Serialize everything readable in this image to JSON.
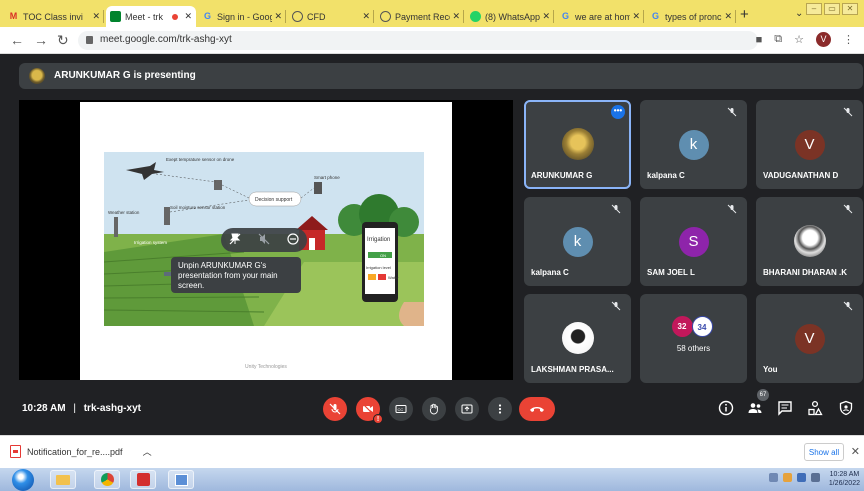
{
  "browser": {
    "tabs": [
      {
        "label": "TOC Class invi",
        "icon": "gmail-icon",
        "active": false
      },
      {
        "label": "Meet - trk",
        "icon": "meet-icon",
        "active": true
      },
      {
        "label": "Sign in - Goog",
        "icon": "google-icon",
        "active": false
      },
      {
        "label": "CFD",
        "icon": "globe-icon",
        "active": false
      },
      {
        "label": "Payment Rece",
        "icon": "globe-icon",
        "active": false
      },
      {
        "label": "(8) WhatsApp",
        "icon": "whatsapp-icon",
        "active": false
      },
      {
        "label": "we are at hom",
        "icon": "google-icon",
        "active": false
      },
      {
        "label": "types of pronc",
        "icon": "google-icon",
        "active": false
      }
    ],
    "url": "meet.google.com/trk-ashg-xyt",
    "profile_initial": "V"
  },
  "meeting": {
    "presenting_text": "ARUNKUMAR G is presenting",
    "time": "10:28 AM",
    "separator": "|",
    "code": "trk-ashg-xyt",
    "tooltip": "Unpin ARUNKUMAR G's presentation from your main screen.",
    "participant_count": "67",
    "slide": {
      "labels": {
        "thermal": "Exept temprature sensor on drone",
        "weather": "Weather station",
        "soil": "Soil moisture sensor station",
        "irrigation_system": "Irrigation system",
        "decision": "Decision support",
        "smartphone": "Smart phone",
        "irrigation_title": "Irrigation",
        "irrigation_on": "ON",
        "irrigation_level": "Irrigation level",
        "irrigation_water": "Water"
      },
      "footer": "Unity Technologies"
    },
    "tiles": [
      {
        "name": "ARUNKUMAR G",
        "type": "image",
        "speaking": true
      },
      {
        "name": "kalpana C",
        "type": "letter",
        "letter": "k",
        "color": "#5f8eb0"
      },
      {
        "name": "VADUGANATHAN D",
        "type": "letter",
        "letter": "V",
        "color": "#7b3325"
      },
      {
        "name": "kalpana C",
        "type": "letter",
        "letter": "k",
        "color": "#5f8eb0"
      },
      {
        "name": "SAM JOEL L",
        "type": "letter",
        "letter": "S",
        "color": "#8e24aa"
      },
      {
        "name": "BHARANI DHARAN .K",
        "type": "image"
      },
      {
        "name": "LAKSHMAN PRASA...",
        "type": "image"
      },
      {
        "name": "",
        "type": "others",
        "mini": [
          "32",
          "34"
        ],
        "count_label": "58 others"
      },
      {
        "name": "You",
        "type": "letter",
        "letter": "V",
        "color": "#7b3325"
      }
    ]
  },
  "download": {
    "filename": "Notification_for_re....pdf",
    "show_all": "Show all"
  },
  "taskbar": {
    "clock_time": "10:28 AM",
    "clock_date": "1/26/2022"
  },
  "colors": {
    "meet_bg": "#202124",
    "tile_bg": "#3c4043",
    "accent_red": "#ea4335",
    "accent_blue": "#8ab4f8",
    "tab_strip": "#f2e16a"
  }
}
